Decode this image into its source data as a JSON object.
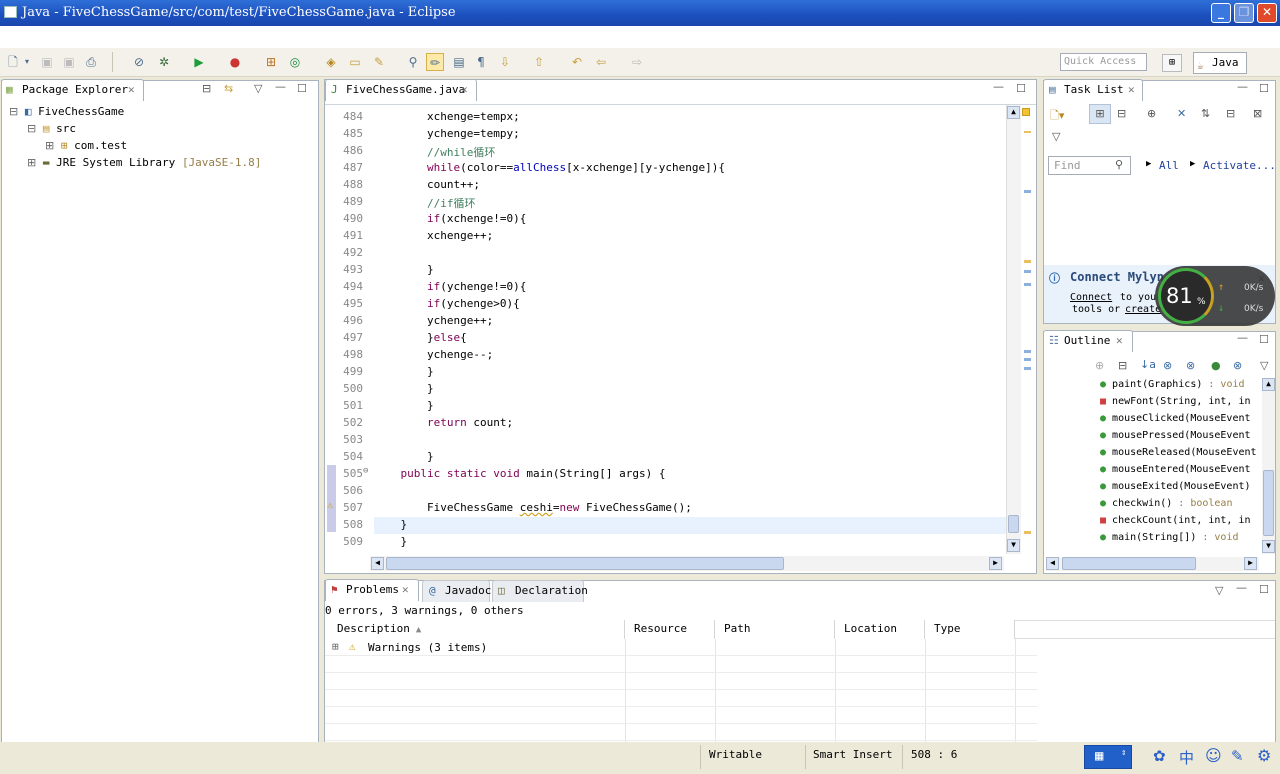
{
  "window": {
    "title": "Java - FiveChessGame/src/com/test/FiveChessGame.java - Eclipse"
  },
  "toolbar": {
    "quick_access_placeholder": "Quick Access",
    "perspective": "Java"
  },
  "package_explorer": {
    "tab_label": "Package Explorer",
    "tree": [
      {
        "label": "FiveChessGame"
      },
      {
        "label": "src"
      },
      {
        "label": "com.test"
      },
      {
        "label": "JRE System Library",
        "suffix": "[JavaSE-1.8]"
      }
    ]
  },
  "editor": {
    "tab_label": "FiveChessGame.java",
    "lines": [
      {
        "num": "484",
        "code": "        xchenge=tempx;"
      },
      {
        "num": "485",
        "code": "        ychenge=tempy;"
      },
      {
        "num": "486",
        "code": "        //while循环"
      },
      {
        "num": "487",
        "code": "        while(color==allChess[x-xchenge][y-ychenge]){"
      },
      {
        "num": "488",
        "code": "        count++;"
      },
      {
        "num": "489",
        "code": "        //if循环"
      },
      {
        "num": "490",
        "code": "        if(xchenge!=0){"
      },
      {
        "num": "491",
        "code": "        xchenge++;"
      },
      {
        "num": "492",
        "code": ""
      },
      {
        "num": "493",
        "code": "        }"
      },
      {
        "num": "494",
        "code": "        if(ychenge!=0){"
      },
      {
        "num": "495",
        "code": "        if(ychenge>0){"
      },
      {
        "num": "496",
        "code": "        ychenge++;"
      },
      {
        "num": "497",
        "code": "        }else{"
      },
      {
        "num": "498",
        "code": "        ychenge--;"
      },
      {
        "num": "499",
        "code": "        }"
      },
      {
        "num": "500",
        "code": "        }"
      },
      {
        "num": "501",
        "code": "        }"
      },
      {
        "num": "502",
        "code": "        return count;"
      },
      {
        "num": "503",
        "code": ""
      },
      {
        "num": "504",
        "code": "        }"
      },
      {
        "num": "505",
        "code": "    public static void main(String[] args) {"
      },
      {
        "num": "506",
        "code": ""
      },
      {
        "num": "507",
        "code": "        FiveChessGame ceshi=new FiveChessGame();"
      },
      {
        "num": "508",
        "code": "    }"
      },
      {
        "num": "509",
        "code": "    }"
      }
    ]
  },
  "task_list": {
    "tab_label": "Task List",
    "find_placeholder": "Find",
    "all_label": "All",
    "activate_label": "Activate...",
    "connect_title": "Connect Mylyn",
    "connect_link": "Connect",
    "connect_text1": "to your",
    "connect_text2": "tools or",
    "create_link": "create"
  },
  "overlay": {
    "percent": "81",
    "percent_sign": "%",
    "up_speed": "0K/s",
    "down_speed": "0K/s"
  },
  "outline": {
    "tab_label": "Outline",
    "items": [
      {
        "label": "paint(Graphics)",
        "type": " : void"
      },
      {
        "label": "newFont(String, int, in",
        "type": ""
      },
      {
        "label": "mouseClicked(MouseEvent",
        "type": ""
      },
      {
        "label": "mousePressed(MouseEvent",
        "type": ""
      },
      {
        "label": "mouseReleased(MouseEvent",
        "type": ""
      },
      {
        "label": "mouseEntered(MouseEvent",
        "type": ""
      },
      {
        "label": "mouseExited(MouseEvent)",
        "type": ""
      },
      {
        "label": "checkwin()",
        "type": " : boolean"
      },
      {
        "label": "checkCount(int, int, in",
        "type": ""
      },
      {
        "label": "main(String[])",
        "type": " : void"
      }
    ]
  },
  "problems": {
    "tabs": [
      "Problems",
      "Javadoc",
      "Declaration"
    ],
    "summary": "0 errors, 3 warnings, 0 others",
    "columns": [
      "Description",
      "Resource",
      "Path",
      "Location",
      "Type"
    ],
    "rows": [
      {
        "description": "Warnings (3 items)"
      }
    ]
  },
  "statusbar": {
    "writable": "Writable",
    "insert_mode": "Smart Insert",
    "position": "508 : 6",
    "ime_text": "中"
  }
}
